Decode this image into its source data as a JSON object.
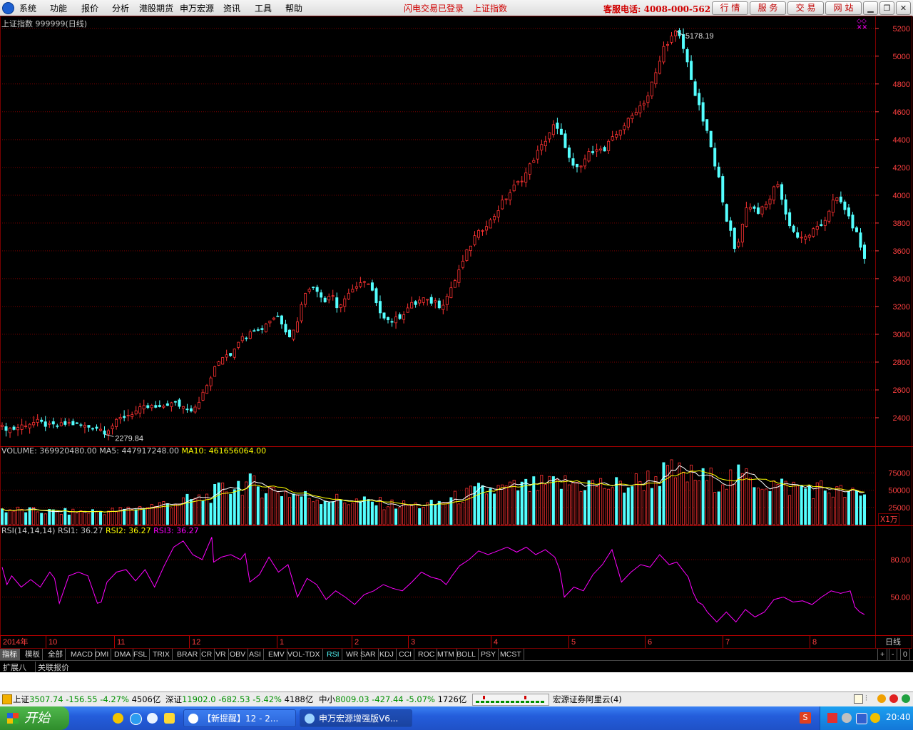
{
  "menubar": {
    "items": [
      "系统",
      "功能",
      "报价",
      "分析",
      "港股期货",
      "申万宏源",
      "资讯",
      "工具",
      "帮助"
    ],
    "notice1": "闪电交易已登录",
    "notice2": "上证指数",
    "phone": "客服电话: 4008-000-562",
    "buttons": [
      "行 情",
      "服 务",
      "交 易",
      "网 站"
    ],
    "window_controls": [
      "minimize-icon",
      "restore-icon",
      "close-icon"
    ]
  },
  "chart_header": {
    "title": "上证指数 999999(日线)",
    "high_label": "5178.19",
    "low_label": "2279.84"
  },
  "volume_header": {
    "volume": "VOLUME: 369920480.00",
    "ma5": "MA5: 447917248.00",
    "ma10": "MA10: 461656064.00",
    "unit": "X1万"
  },
  "rsi_header": {
    "name": "RSI(14,14,14)",
    "rsi1": "RSI1: 36.27",
    "rsi2": "RSI2: 36.27",
    "rsi3": "RSI3: 36.27"
  },
  "colors": {
    "up": "#ff3232",
    "down": "#54ffff",
    "ma5": "#ffffff",
    "ma10": "#ffff00",
    "rsi": "#ff00ff",
    "grid": "#7a0000",
    "axis_text": "#ff4040"
  },
  "x_axis": {
    "labels": [
      "2014年",
      "10",
      "11",
      "12",
      "1",
      "2",
      "3",
      "4",
      "5",
      "6",
      "7",
      "8"
    ],
    "period": "日线"
  },
  "tabs": [
    "指标",
    "模板",
    "全部",
    "MACD",
    "DMI",
    "DMA",
    "FSL",
    "TRIX",
    "BRAR",
    "CR",
    "VR",
    "OBV",
    "ASI",
    "EMV",
    "VOL-TDX",
    "RSI",
    "WR",
    "SAR",
    "KDJ",
    "CCI",
    "ROC",
    "MTM",
    "BOLL",
    "PSY",
    "MCST"
  ],
  "active_tab": "RSI",
  "tab_controls": [
    "+",
    "-",
    "0"
  ],
  "ext_tabs": [
    "扩展八",
    "关联报价"
  ],
  "status": {
    "sh_name": "上证",
    "sh_value": "3507.74",
    "sh_change": "-156.55",
    "sh_pct": "-4.27%",
    "sh_amount": "4506亿",
    "sz_name": "深证",
    "sz_value": "11902.0",
    "sz_change": "-682.53",
    "sz_pct": "-5.42%",
    "sz_amount": "4188亿",
    "zx_name": "中小",
    "zx_value": "8009.03",
    "zx_change": "-427.44",
    "zx_pct": "-5.07%",
    "zx_amount": "1726亿",
    "broker": "宏源证券阿里云(4)"
  },
  "taskbar": {
    "start": "开始",
    "tasks": [
      "【新提醒】12 - 2...",
      "申万宏源增强版V6..."
    ],
    "clock": "20:40"
  },
  "chart_data": [
    {
      "type": "candlestick",
      "title": "上证指数 999999(日线)",
      "ylim": [
        2200,
        5250
      ],
      "yticks": [
        2400,
        2600,
        2800,
        3000,
        3200,
        3400,
        3600,
        3800,
        4000,
        4200,
        4400,
        4600,
        4800,
        5000,
        5200
      ],
      "annotations": [
        {
          "text": "5178.19",
          "value": 5178.19
        },
        {
          "text": "2279.84",
          "value": 2279.84
        }
      ],
      "grid": true,
      "legend": "none",
      "anchors": [
        [
          0,
          2330
        ],
        [
          12,
          2320
        ],
        [
          25,
          2355
        ],
        [
          37,
          2370
        ],
        [
          50,
          2340
        ],
        [
          60,
          2345
        ],
        [
          70,
          2360
        ],
        [
          80,
          2350
        ],
        [
          90,
          2335
        ],
        [
          100,
          2330
        ],
        [
          108,
          2300
        ],
        [
          115,
          2340
        ],
        [
          125,
          2400
        ],
        [
          135,
          2430
        ],
        [
          148,
          2470
        ],
        [
          158,
          2480
        ],
        [
          165,
          2460
        ],
        [
          172,
          2500
        ],
        [
          182,
          2500
        ],
        [
          190,
          2480
        ],
        [
          200,
          2460
        ],
        [
          210,
          2560
        ],
        [
          217,
          2660
        ],
        [
          225,
          2780
        ],
        [
          233,
          2860
        ],
        [
          240,
          2860
        ],
        [
          248,
          2960
        ],
        [
          255,
          2980
        ],
        [
          262,
          3050
        ],
        [
          270,
          3020
        ],
        [
          277,
          3080
        ],
        [
          284,
          3120
        ],
        [
          290,
          3130
        ],
        [
          297,
          3040
        ],
        [
          303,
          2980
        ],
        [
          309,
          3080
        ],
        [
          315,
          3230
        ],
        [
          320,
          3350
        ],
        [
          326,
          3330
        ],
        [
          333,
          3300
        ],
        [
          340,
          3230
        ],
        [
          345,
          3330
        ],
        [
          352,
          3175
        ],
        [
          358,
          3250
        ],
        [
          366,
          3290
        ],
        [
          373,
          3370
        ],
        [
          380,
          3370
        ],
        [
          387,
          3340
        ],
        [
          393,
          3200
        ],
        [
          400,
          3140
        ],
        [
          407,
          3090
        ],
        [
          414,
          3110
        ],
        [
          421,
          3150
        ],
        [
          428,
          3210
        ],
        [
          434,
          3220
        ],
        [
          441,
          3260
        ],
        [
          447,
          3230
        ],
        [
          454,
          3240
        ],
        [
          460,
          3200
        ],
        [
          466,
          3260
        ],
        [
          472,
          3350
        ],
        [
          478,
          3420
        ],
        [
          484,
          3540
        ],
        [
          490,
          3620
        ],
        [
          496,
          3700
        ],
        [
          502,
          3740
        ],
        [
          507,
          3790
        ],
        [
          512,
          3810
        ],
        [
          518,
          3870
        ],
        [
          525,
          3950
        ],
        [
          531,
          4000
        ],
        [
          537,
          4060
        ],
        [
          543,
          4100
        ],
        [
          549,
          4150
        ],
        [
          555,
          4230
        ],
        [
          561,
          4300
        ],
        [
          566,
          4350
        ],
        [
          572,
          4420
        ],
        [
          578,
          4500
        ],
        [
          584,
          4460
        ],
        [
          590,
          4380
        ],
        [
          596,
          4240
        ],
        [
          601,
          4180
        ],
        [
          607,
          4200
        ],
        [
          613,
          4280
        ],
        [
          619,
          4320
        ],
        [
          625,
          4350
        ],
        [
          631,
          4300
        ],
        [
          637,
          4380
        ],
        [
          643,
          4420
        ],
        [
          649,
          4480
        ],
        [
          655,
          4520
        ],
        [
          660,
          4560
        ],
        [
          666,
          4620
        ],
        [
          672,
          4660
        ],
        [
          677,
          4700
        ],
        [
          683,
          4830
        ],
        [
          688,
          4900
        ],
        [
          693,
          5050
        ],
        [
          698,
          5100
        ],
        [
          703,
          5140
        ],
        [
          708,
          5178
        ],
        [
          713,
          5100
        ],
        [
          718,
          4980
        ],
        [
          723,
          4850
        ],
        [
          728,
          4700
        ],
        [
          733,
          4600
        ],
        [
          738,
          4480
        ],
        [
          743,
          4380
        ],
        [
          748,
          4200
        ],
        [
          753,
          4100
        ],
        [
          758,
          3900
        ],
        [
          762,
          3780
        ],
        [
          766,
          3700
        ],
        [
          770,
          3560
        ],
        [
          775,
          3750
        ],
        [
          780,
          3900
        ],
        [
          786,
          3930
        ],
        [
          792,
          3880
        ],
        [
          798,
          3900
        ],
        [
          804,
          3950
        ],
        [
          810,
          4050
        ],
        [
          815,
          4100
        ],
        [
          820,
          3900
        ],
        [
          826,
          3800
        ],
        [
          832,
          3720
        ],
        [
          838,
          3680
        ],
        [
          844,
          3700
        ],
        [
          850,
          3740
        ],
        [
          856,
          3760
        ],
        [
          862,
          3800
        ],
        [
          868,
          3900
        ],
        [
          874,
          3980
        ],
        [
          880,
          3950
        ],
        [
          885,
          3900
        ],
        [
          890,
          3800
        ],
        [
          895,
          3760
        ],
        [
          900,
          3650
        ],
        [
          905,
          3540
        ]
      ]
    },
    {
      "type": "bar",
      "title": "VOLUME",
      "ylabel": "X1万",
      "ylim": [
        0,
        95000
      ],
      "yticks": [
        25000,
        50000,
        75000
      ],
      "series": [
        {
          "name": "VOLUME"
        },
        {
          "name": "MA5"
        },
        {
          "name": "MA10"
        }
      ],
      "anchors": [
        [
          0,
          22000
        ],
        [
          60,
          18000
        ],
        [
          120,
          20000
        ],
        [
          170,
          30000
        ],
        [
          210,
          38000
        ],
        [
          250,
          60000
        ],
        [
          270,
          55000
        ],
        [
          320,
          40000
        ],
        [
          360,
          35000
        ],
        [
          420,
          28000
        ],
        [
          450,
          28000
        ],
        [
          500,
          48000
        ],
        [
          560,
          55000
        ],
        [
          600,
          60000
        ],
        [
          650,
          55000
        ],
        [
          700,
          75000
        ],
        [
          740,
          65000
        ],
        [
          780,
          68000
        ],
        [
          820,
          55000
        ],
        [
          860,
          52000
        ],
        [
          905,
          40000
        ]
      ]
    },
    {
      "type": "line",
      "title": "RSI(14,14,14)",
      "ylim": [
        20,
        100
      ],
      "yticks": [
        50,
        80
      ],
      "series": [
        {
          "name": "RSI1"
        },
        {
          "name": "RSI2"
        },
        {
          "name": "RSI3"
        }
      ],
      "anchors": [
        [
          0,
          74
        ],
        [
          5,
          60
        ],
        [
          10,
          67
        ],
        [
          20,
          58
        ],
        [
          30,
          64
        ],
        [
          40,
          58
        ],
        [
          50,
          70
        ],
        [
          55,
          65
        ],
        [
          60,
          45
        ],
        [
          70,
          67
        ],
        [
          80,
          70
        ],
        [
          90,
          67
        ],
        [
          100,
          45
        ],
        [
          104,
          46
        ],
        [
          110,
          62
        ],
        [
          120,
          70
        ],
        [
          130,
          72
        ],
        [
          140,
          63
        ],
        [
          150,
          72
        ],
        [
          160,
          58
        ],
        [
          170,
          75
        ],
        [
          180,
          90
        ],
        [
          190,
          95
        ],
        [
          200,
          84
        ],
        [
          210,
          80
        ],
        [
          220,
          98
        ],
        [
          222,
          78
        ],
        [
          230,
          82
        ],
        [
          240,
          84
        ],
        [
          250,
          80
        ],
        [
          255,
          85
        ],
        [
          260,
          62
        ],
        [
          270,
          68
        ],
        [
          280,
          82
        ],
        [
          290,
          70
        ],
        [
          300,
          76
        ],
        [
          310,
          50
        ],
        [
          320,
          65
        ],
        [
          330,
          60
        ],
        [
          340,
          48
        ],
        [
          350,
          55
        ],
        [
          360,
          50
        ],
        [
          370,
          44
        ],
        [
          380,
          52
        ],
        [
          390,
          55
        ],
        [
          400,
          60
        ],
        [
          410,
          57
        ],
        [
          420,
          55
        ],
        [
          430,
          62
        ],
        [
          440,
          70
        ],
        [
          450,
          66
        ],
        [
          460,
          64
        ],
        [
          466,
          60
        ],
        [
          472,
          67
        ],
        [
          480,
          75
        ],
        [
          490,
          80
        ],
        [
          500,
          87
        ],
        [
          510,
          84
        ],
        [
          520,
          87
        ],
        [
          530,
          90
        ],
        [
          540,
          86
        ],
        [
          550,
          90
        ],
        [
          560,
          84
        ],
        [
          570,
          88
        ],
        [
          580,
          82
        ],
        [
          585,
          72
        ],
        [
          590,
          50
        ],
        [
          600,
          58
        ],
        [
          610,
          55
        ],
        [
          620,
          68
        ],
        [
          630,
          76
        ],
        [
          640,
          88
        ],
        [
          650,
          62
        ],
        [
          660,
          70
        ],
        [
          670,
          76
        ],
        [
          680,
          74
        ],
        [
          690,
          84
        ],
        [
          700,
          76
        ],
        [
          708,
          78
        ],
        [
          713,
          73
        ],
        [
          720,
          66
        ],
        [
          725,
          54
        ],
        [
          730,
          46
        ],
        [
          735,
          44
        ],
        [
          740,
          38
        ],
        [
          750,
          30
        ],
        [
          760,
          38
        ],
        [
          770,
          30
        ],
        [
          780,
          40
        ],
        [
          790,
          34
        ],
        [
          800,
          38
        ],
        [
          810,
          48
        ],
        [
          820,
          50
        ],
        [
          830,
          46
        ],
        [
          840,
          47
        ],
        [
          850,
          44
        ],
        [
          860,
          50
        ],
        [
          870,
          55
        ],
        [
          880,
          53
        ],
        [
          890,
          55
        ],
        [
          895,
          42
        ],
        [
          900,
          38
        ],
        [
          905,
          36
        ]
      ]
    }
  ]
}
